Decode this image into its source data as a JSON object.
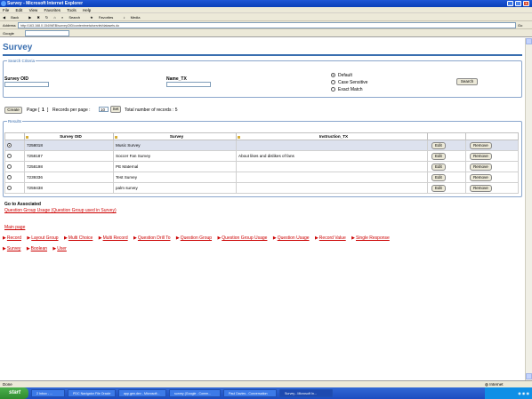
{
  "window": {
    "title": "Survey - Microsoft Internet Explorer"
  },
  "menu": [
    "File",
    "Edit",
    "View",
    "Favorites",
    "Tools",
    "Help"
  ],
  "toolbar": {
    "back": "Back",
    "search": "Search",
    "favorites": "Favorites",
    "media": "Media"
  },
  "address": {
    "label": "Address",
    "value": "http://163.168.0.154/WEB/surveyOID/contentmeta/servlet/datasets.do",
    "go": "Go",
    "links": "Links"
  },
  "googlebar": {
    "label": "Google"
  },
  "page": {
    "title": "Survey",
    "search": {
      "legend": "Search Criteria",
      "oid_label": "Survey OID",
      "name_label": "Name_TX",
      "options": [
        "Default",
        "Case Sensitive",
        "Exact Match"
      ],
      "selected_option": "Default",
      "search_button": "Search"
    },
    "paging": {
      "create": "Create",
      "page_label": "Page [",
      "page_value": "1",
      "page_close": "]",
      "records_label": "Records per page :",
      "records_value": "10",
      "set": "Set",
      "total_label": "Total number of records : 5"
    },
    "results": {
      "legend": "Results",
      "columns": [
        "Survey OID",
        "Survey",
        "Instruction_TX"
      ],
      "rows": [
        {
          "oid": "7258018",
          "survey": "Music Survey",
          "instruction": ""
        },
        {
          "oid": "7258187",
          "survey": "Soccer Fan Survey",
          "instruction": "About likes and dislikes of fans"
        },
        {
          "oid": "7258198",
          "survey": "PE Maternal",
          "instruction": ""
        },
        {
          "oid": "7239336",
          "survey": "Test Survey",
          "instruction": ""
        },
        {
          "oid": "7259438",
          "survey": "palm survey",
          "instruction": ""
        }
      ],
      "edit_label": "Edit",
      "remove_label": "Remove"
    },
    "associated": {
      "heading": "Go to Associated",
      "link": "Question Group Usage (Question Group used in Survey)"
    },
    "main_page_link": "Main page",
    "nav_row1": [
      "Record",
      "Layout Group",
      "Multi Choice",
      "Multi Record",
      "Question Drill To",
      "Question Group",
      "Question Group Usage",
      "Question Usage",
      "Record Value",
      "Single Response"
    ],
    "nav_row2": [
      "Survey",
      "Boolean",
      "User"
    ]
  },
  "status": {
    "left": "Done",
    "zone": "Internet"
  },
  "taskbar": {
    "start": "start",
    "tasks": [
      "2 Inbox - ...",
      "PDC Navigator File Oracle",
      "app.gen.dev - Microsoft...",
      "survey (Google - Comm...",
      "Paul Davies - Conversation",
      "Survey - Microsoft In..."
    ],
    "clock": ""
  }
}
